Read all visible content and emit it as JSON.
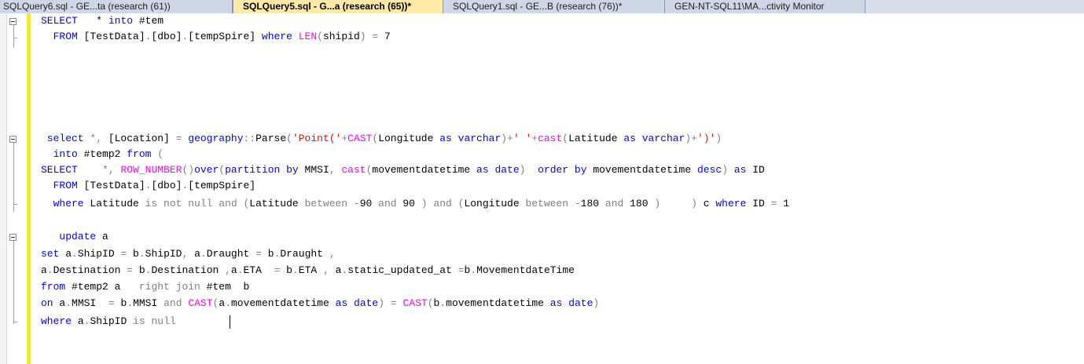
{
  "tabs": [
    {
      "label": "SQLQuery6.sql - GE...ta (research (61))",
      "active": false
    },
    {
      "label": "SQLQuery5.sql - G...a (research (65))*",
      "active": true
    },
    {
      "label": "SQLQuery1.sql - GE...B (research (76))*",
      "active": false
    },
    {
      "label": "GEN-NT-SQL11\\MA...ctivity Monitor",
      "active": false
    }
  ],
  "colors": {
    "keyword": "#0000ff",
    "function": "#ff00ff",
    "string": "#ff0000",
    "operator": "#808080",
    "identifier": "#000000",
    "change_bar": "#f2e83a"
  },
  "code": {
    "l1": {
      "t0": "SELECT",
      "t1": "   * ",
      "t2": "into",
      "t3": " #tem"
    },
    "l2": {
      "t0": "  FROM ",
      "t1": "[TestData]",
      "t2": ".",
      "t3": "[dbo]",
      "t4": ".",
      "t5": "[tempSpire] ",
      "t6": "where",
      "t7": " ",
      "t8": "LEN",
      "t9": "(",
      "t10": "shipid",
      "t11": ")",
      "t12": " ",
      "t13": "=",
      "t14": " 7"
    },
    "l3": {
      "t0": " select",
      "t1": " ",
      "t2": "*,",
      "t3": " [Location] ",
      "t4": "=",
      "t5": " ",
      "t6": "geography",
      "t7": "::",
      "t8": "Parse",
      "t9": "(",
      "t10": "'Point('",
      "t11": "+",
      "t12": "CAST",
      "t13": "(",
      "t14": "Longitude ",
      "t15": "as",
      "t16": " ",
      "t17": "varchar",
      "t18": ")+",
      "t19": "' '",
      "t20": "+",
      "t21": "cast",
      "t22": "(",
      "t23": "Latitude ",
      "t24": "as",
      "t25": " ",
      "t26": "varchar",
      "t27": ")+",
      "t28": "')'",
      "t29": ")"
    },
    "l4": {
      "t0": "  into",
      "t1": " #temp2 ",
      "t2": "from",
      "t3": " ",
      "t4": "("
    },
    "l5": {
      "t0": "SELECT",
      "t1": "   ",
      "t2": " *,",
      "t3": " ",
      "t4": "ROW_NUMBER",
      "t5": "()",
      "t6": "over",
      "t7": "(",
      "t8": "partition",
      "t9": " ",
      "t10": "by",
      "t11": " MMSI",
      "t12": ",",
      "t13": " ",
      "t14": "cast",
      "t15": "(",
      "t16": "movementdatetime ",
      "t17": "as",
      "t18": " ",
      "t19": "date",
      "t20": ")",
      "t21": "  ",
      "t22": "order",
      "t23": " ",
      "t24": "by",
      "t25": " movementdatetime ",
      "t26": "desc",
      "t27": ")",
      "t28": " ",
      "t29": "as",
      "t30": " ID"
    },
    "l6": {
      "t0": "  FROM ",
      "t1": "[TestData]",
      "t2": ".",
      "t3": "[dbo]",
      "t4": ".",
      "t5": "[tempSpire]"
    },
    "l7": {
      "t0": "  where",
      "t1": " Latitude ",
      "t2": "is not null and",
      "t3": " ",
      "t4": "(",
      "t5": "Latitude ",
      "t6": "between",
      "t7": " ",
      "t8": "-",
      "t9": "90 ",
      "t10": "and",
      "t11": " 90 ",
      "t12": ")",
      "t13": " ",
      "t14": "and",
      "t15": " ",
      "t16": "(",
      "t17": "Longitude ",
      "t18": "between",
      "t19": " ",
      "t20": "-",
      "t21": "180 ",
      "t22": "and",
      "t23": " 180 ",
      "t24": ")",
      "t25": "     ",
      "t26": ")",
      "t27": " c ",
      "t28": "where",
      "t29": " ID ",
      "t30": "=",
      "t31": " 1"
    },
    "l8": {
      "t0": "   update",
      "t1": " a"
    },
    "l9": {
      "t0": "set",
      "t1": " a",
      "t2": ".",
      "t3": "ShipID ",
      "t4": "=",
      "t5": " b",
      "t6": ".",
      "t7": "ShipID",
      "t8": ",",
      "t9": " a",
      "t10": ".",
      "t11": "Draught ",
      "t12": "=",
      "t13": " b",
      "t14": ".",
      "t15": "Draught ",
      "t16": ","
    },
    "l10": {
      "t0": "a",
      "t1": ".",
      "t2": "Destination ",
      "t3": "=",
      "t4": " b",
      "t5": ".",
      "t6": "Destination ",
      "t7": ",",
      "t8": "a",
      "t9": ".",
      "t10": "ETA  ",
      "t11": "=",
      "t12": " b",
      "t13": ".",
      "t14": "ETA ",
      "t15": ",",
      "t16": " a",
      "t17": ".",
      "t18": "static_updated_at ",
      "t19": "=",
      "t20": "b",
      "t21": ".",
      "t22": "MovementdateTime"
    },
    "l11": {
      "t0": "from",
      "t1": " #temp2 a   ",
      "t2": "right join",
      "t3": " #tem  b"
    },
    "l12": {
      "t0": "on",
      "t1": " a",
      "t2": ".",
      "t3": "MMSI  ",
      "t4": "=",
      "t5": " b",
      "t6": ".",
      "t7": "MMSI ",
      "t8": "and",
      "t9": " ",
      "t10": "CAST",
      "t11": "(",
      "t12": "a",
      "t13": ".",
      "t14": "movementdatetime ",
      "t15": "as",
      "t16": " ",
      "t17": "date",
      "t18": ")",
      "t19": " ",
      "t20": "=",
      "t21": " ",
      "t22": "CAST",
      "t23": "(",
      "t24": "b",
      "t25": ".",
      "t26": "movementdatetime ",
      "t27": "as",
      "t28": " ",
      "t29": "date",
      "t30": ")"
    },
    "l13": {
      "t0": "where",
      "t1": " a",
      "t2": ".",
      "t3": "ShipID ",
      "t4": "is",
      "t5": " ",
      "t6": "null",
      "t7": "  "
    }
  }
}
